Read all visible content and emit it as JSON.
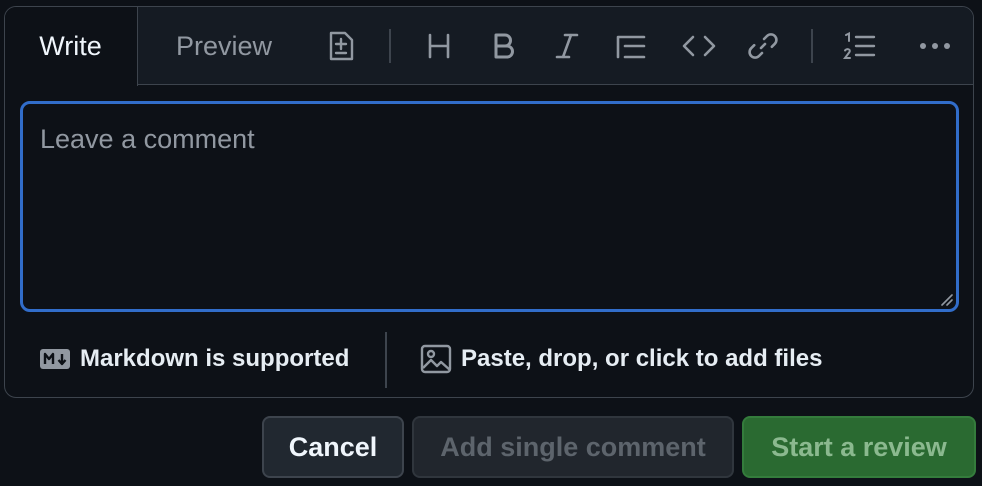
{
  "tabs": {
    "write": "Write",
    "preview": "Preview"
  },
  "toolbar": {
    "icons": [
      "diff-icon",
      "heading-icon",
      "bold-icon",
      "italic-icon",
      "quote-icon",
      "code-icon",
      "link-icon",
      "ordered-list-icon",
      "more-icon"
    ]
  },
  "comment": {
    "placeholder": "Leave a comment",
    "value": ""
  },
  "footer": {
    "markdown_note": "Markdown is supported",
    "attach_note": "Paste, drop, or click to add files"
  },
  "buttons": {
    "cancel": "Cancel",
    "add_single": "Add single comment",
    "start_review": "Start a review"
  },
  "colors": {
    "background": "#0d1117",
    "focus_border": "#316dca",
    "primary_button": "#2a6a31"
  }
}
